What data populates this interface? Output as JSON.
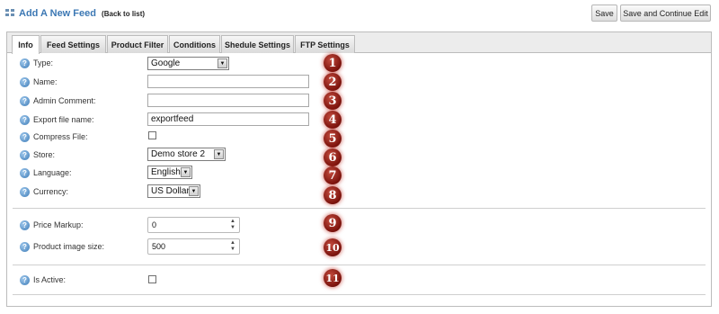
{
  "header": {
    "title": "Add A New Feed",
    "back_link": "(Back to list)",
    "save_label": "Save",
    "save_continue_label": "Save and Continue Edit"
  },
  "tabs": [
    {
      "label": "Info"
    },
    {
      "label": "Feed Settings"
    },
    {
      "label": "Product Filter"
    },
    {
      "label": "Conditions"
    },
    {
      "label": "Shedule Settings"
    },
    {
      "label": "FTP Settings"
    }
  ],
  "fields": {
    "type": {
      "label": "Type:",
      "value": "Google"
    },
    "name": {
      "label": "Name:",
      "value": ""
    },
    "admin_comment": {
      "label": "Admin Comment:",
      "value": ""
    },
    "export_file_name": {
      "label": "Export file name:",
      "value": "exportfeed"
    },
    "compress_file": {
      "label": "Compress File:",
      "checked": false
    },
    "store": {
      "label": "Store:",
      "value": "Demo store 2"
    },
    "language": {
      "label": "Language:",
      "value": "English"
    },
    "currency": {
      "label": "Currency:",
      "value": "US Dollar"
    },
    "price_markup": {
      "label": "Price Markup:",
      "value": "0"
    },
    "product_image_size": {
      "label": "Product image size:",
      "value": "500"
    },
    "is_active": {
      "label": "Is Active:",
      "checked": false
    }
  },
  "help_glyph": "?",
  "badges": [
    "1",
    "2",
    "3",
    "4",
    "5",
    "6",
    "7",
    "8",
    "9",
    "10",
    "11"
  ],
  "colors": {
    "title": "#3c78b4",
    "badge": "#8e1a12",
    "help_icon": "#3f7db8"
  }
}
